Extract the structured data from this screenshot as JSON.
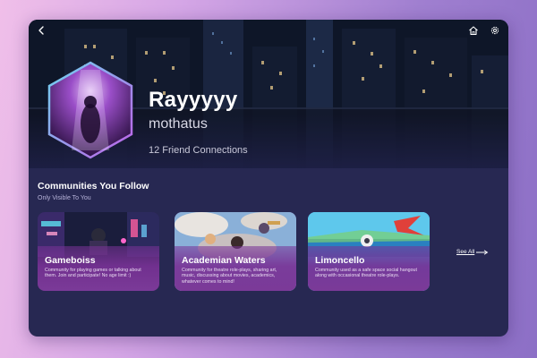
{
  "profile": {
    "display_name": "Rayyyyy",
    "username": "mothatus",
    "connections": "12 Friend Connections"
  },
  "header": {
    "back_icon": "chevron-left-icon",
    "home_icon": "home-icon",
    "settings_icon": "gear-icon"
  },
  "communities": {
    "title": "Communities You Follow",
    "subtitle": "Only Visible To You",
    "see_all": "See All",
    "items": [
      {
        "name": "Gameboiss",
        "description": "Community for playing games or talking about them. Join and participate! No age limit :)"
      },
      {
        "name": "Academian Waters",
        "description": "Community for theatre role-plays, sharing art, music, discussing about movies, academics, whatever comes to mind!"
      },
      {
        "name": "Limoncello",
        "description": "Community used as a safe space social hangout along with occasional theatre role-plays."
      }
    ]
  },
  "colors": {
    "panel": "#272852",
    "card": "#7b3a98",
    "accent": "#5ab8e6"
  }
}
